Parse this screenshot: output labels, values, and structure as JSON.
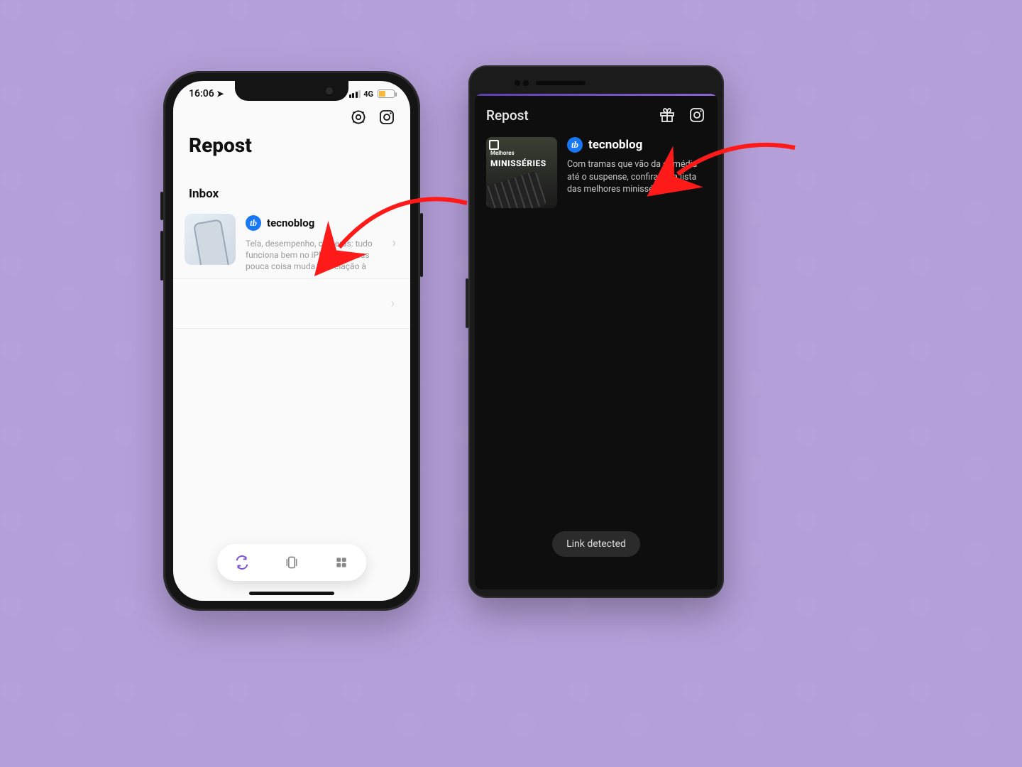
{
  "ios": {
    "status": {
      "time": "16:06",
      "network_label": "4G"
    },
    "title": "Repost",
    "section": "Inbox",
    "item": {
      "username": "tecnoblog",
      "avatar_letter": "tb",
      "description": "Tela, desempenho, câmeras: tudo funciona bem no iPhone 14, mas pouca coisa muda em relação à"
    }
  },
  "android": {
    "title": "Repost",
    "item": {
      "username": "tecnoblog",
      "avatar_letter": "tb",
      "description": "Com tramas que vão da comédia até o suspense, confira uma lista das melhores minisséries!",
      "thumb_banner": "Melhores",
      "thumb_title": "MINISSÉRIES"
    },
    "toast": "Link detected"
  },
  "colors": {
    "background": "#b59fd9",
    "tb_blue": "#1877f2",
    "accent_purple": "#7a4fd6",
    "annotation_red": "#ff1a1a"
  }
}
